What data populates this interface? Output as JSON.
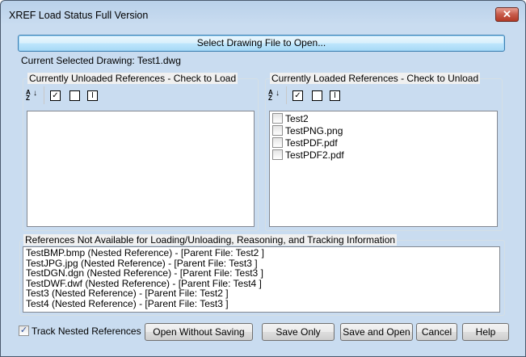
{
  "window": {
    "title": "XREF Load Status Full Version",
    "close_icon": "close-icon"
  },
  "select_button": "Select Drawing File to Open...",
  "current_drawing": "Current Selected Drawing: Test1.dwg",
  "unloaded": {
    "label": "Currently Unloaded References  -  Check to Load",
    "items": []
  },
  "loaded": {
    "label": "Currently Loaded References  -  Check to Unload",
    "items": [
      {
        "label": "Test2",
        "checked": false
      },
      {
        "label": "TestPNG.png",
        "checked": false
      },
      {
        "label": "TestPDF.pdf",
        "checked": false
      },
      {
        "label": "TestPDF2.pdf",
        "checked": false
      }
    ]
  },
  "toolbar": {
    "sort_a": "A",
    "sort_z": "Z",
    "check_glyph": "✓",
    "invert_glyph": "I"
  },
  "nested": {
    "label": "References Not Available for Loading/Unloading, Reasoning, and Tracking Information",
    "items": [
      "TestBMP.bmp (Nested Reference) - [Parent File: Test2 ]",
      "TestJPG.jpg (Nested Reference) - [Parent File: Test3 ]",
      "TestDGN.dgn (Nested Reference) - [Parent File: Test3 ]",
      "TestDWF.dwf (Nested Reference) - [Parent File: Test4 ]",
      "Test3 (Nested Reference) - [Parent File: Test2 ]",
      "Test4 (Nested Reference) - [Parent File: Test3 ]"
    ]
  },
  "track_nested": {
    "label": "Track Nested References",
    "checked": true
  },
  "buttons": {
    "open_without_saving": "Open Without Saving",
    "save_only": "Save Only",
    "save_and_open": "Save and Open",
    "cancel": "Cancel",
    "help": "Help"
  }
}
